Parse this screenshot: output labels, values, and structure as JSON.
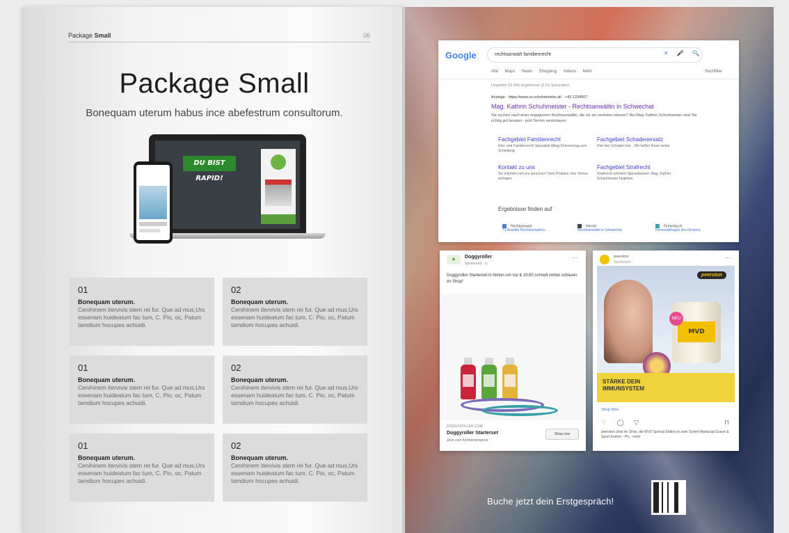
{
  "left_page": {
    "header_prefix": "Package",
    "header_bold": "Small",
    "page_number": "06",
    "title": "Package Small",
    "subtitle": "Bonequam uterum habus ince abefestrum consultorum.",
    "mockup_banner": "DU BIST RAPID!",
    "cards": [
      {
        "num": "01",
        "heading": "Bonequam uterum.",
        "text": "Cenihinem itervivis stem rei fur. Que ad mus,Urs essenam huideatum fac tum, C. Pio, oc, Patum tamdium hocupes achuidi."
      },
      {
        "num": "02",
        "heading": "Bonequam uterum.",
        "text": "Cenihinem itervivis stem rei fur. Que ad mus,Urs essenam huideatum fac tum, C. Pio, oc, Patum tamdium hocupes achuidi."
      },
      {
        "num": "01",
        "heading": "Bonequam uterum.",
        "text": "Cenihinem itervivis stem rei fur. Que ad mus,Urs essenam huideatum fac tum, C. Pio, oc, Patum tamdium hocupes achuidi."
      },
      {
        "num": "02",
        "heading": "Bonequam uterum.",
        "text": "Cenihinem itervivis stem rei fur. Que ad mus,Urs essenam huideatum fac tum, C. Pio, oc, Patum tamdium hocupes achuidi."
      },
      {
        "num": "01",
        "heading": "Bonequam uterum.",
        "text": "Cenihinem itervivis stem rei fur. Que ad mus,Urs essenam huideatum fac tum, C. Pio, oc, Patum tamdium hocupes achuidi."
      },
      {
        "num": "02",
        "heading": "Bonequam uterum.",
        "text": "Cenihinem itervivis stem rei fur. Que ad mus,Urs essenam huideatum fac tum, C. Pio, oc, Patum tamdium hocupes achuidi."
      }
    ]
  },
  "google": {
    "logo": "Google",
    "query": "rechtsanwalt familienrecht",
    "icons": "✕ 🎤 🔍",
    "tabs": "Alle  Maps  News  Shopping  Videos  Mehr",
    "tools": "Suchfilter",
    "result_count": "Ungefähr 32.400 Ergebnisse (0,53 Sekunden)",
    "ad_line": "Anzeige · https://www.ra-schuhmeister.at/ · +43 1234567",
    "ad_title": "Mag. Kathrin Schuhmeister - Rechtsanwältin in Schwechat",
    "ad_desc": "Sie suchen nach einer engagierten Rechtsanwältin, die sie wir vertreten können? Bei Mag. Kathrin Schuhmeister sind Sie richtig gut beraten - jetzt Termin vereinbaren.",
    "sitelinks": [
      {
        "title": "Fachgebiet Familienrecht",
        "desc": "Ehe- und Familienrecht Spezialist Alltag Eheveertrag uvm. Scheidung"
      },
      {
        "title": "Fachgebiet Schadenersatz",
        "desc": "Hier den Schaden bei... Wir helfen Ihnen weiter"
      },
      {
        "title": "Kontakt zu uns",
        "desc": "Sie möchten mit uns sprechen? Kein Problem, hier Termin anfragen"
      },
      {
        "title": "Fachgebiet Strafrecht",
        "desc": "Strafrecht erfordert Spezialwissen. Mag. Kathrin Schuhmeister begleitet."
      }
    ],
    "results_heading": "Ergebnisse finden auf",
    "chips": [
      {
        "label": "Rechtsanwalt",
        "link": "73 Anwälte Rechtsanwalt in..."
      },
      {
        "label": "Herold",
        "link": "Rechtsanwälte in Schwechat"
      },
      {
        "label": "Firmenbuch",
        "link": "Firmenabfragen des Firmens"
      }
    ]
  },
  "facebook_ad": {
    "brand": "Doggyroller",
    "sponsored": "Sponsored · ◎",
    "more": "···",
    "text": "Doggyroller Starterset in Aktion um nur € 19,60 schnell vorbei schauen im Shop!",
    "url": "DOGGYROLLER.COM",
    "title": "Doggyroller Starterset",
    "subtitle": "Jetzt zum Kennenlernpreis",
    "button": "Shop now"
  },
  "instagram_ad": {
    "brand": "peeroton",
    "sponsored": "Sponsored",
    "more": "···",
    "product_brand": "peeroton",
    "new_badge": "NEU",
    "can_label": "MVD",
    "headline": "STÄRKE DEIN IMMUNSYSTEM",
    "shop": "Shop Now",
    "actions": "♡ ◯ ▽",
    "save": "⊓",
    "caption": "peeroton Jetzt im Shop, die MVD Special Edition in zwei Sorten Maracuja-Guave & Sport Kraken - Ph... mehr"
  },
  "cta": "Buche jetzt dein Erstgespräch!"
}
